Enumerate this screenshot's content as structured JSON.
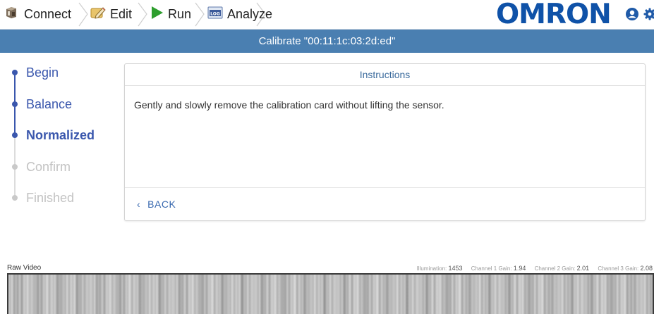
{
  "toolbar": {
    "connect_label": "Connect",
    "edit_label": "Edit",
    "run_label": "Run",
    "analyze_label": "Analyze",
    "logo_text": "OMRON",
    "icons": {
      "connect": "connect-device-icon",
      "edit": "edit-pencil-icon",
      "run": "play-icon",
      "analyze": "log-icon",
      "user": "user-icon",
      "settings": "gear-icon"
    },
    "colors": {
      "logo": "#0f52a8",
      "run": "#2e9e2e"
    }
  },
  "titlebar": {
    "title": "Calibrate \"00:11:1c:03:2d:ed\"",
    "color": "#4a7fb1"
  },
  "steps": [
    {
      "label": "Begin",
      "state": "done"
    },
    {
      "label": "Balance",
      "state": "done"
    },
    {
      "label": "Normalized",
      "state": "active"
    },
    {
      "label": "Confirm",
      "state": "todo"
    },
    {
      "label": "Finished",
      "state": "todo"
    }
  ],
  "panel": {
    "heading": "Instructions",
    "message": "Gently and slowly remove the calibration card without lifting the sensor.",
    "back_label": "BACK"
  },
  "video": {
    "label": "Raw Video",
    "illumination_label": "Illumination:",
    "illumination_value": "1453",
    "ch1_label": "Channel 1 Gain:",
    "ch1_value": "1.94",
    "ch2_label": "Channel 2 Gain:",
    "ch2_value": "2.01",
    "ch3_label": "Channel 3 Gain:",
    "ch3_value": "2.08"
  }
}
